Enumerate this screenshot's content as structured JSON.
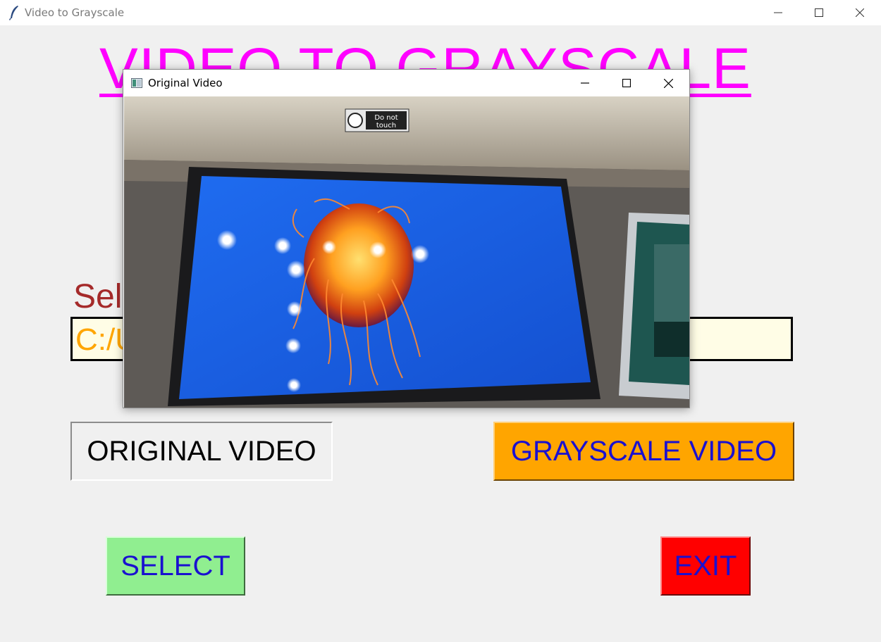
{
  "window": {
    "title": "Video to Grayscale",
    "icon": "feather-icon",
    "controls": [
      "minimize",
      "maximize",
      "close"
    ]
  },
  "main": {
    "heading": "VIDEO TO GRAYSCALE",
    "select_label": "Sel",
    "path_value": "C:/U"
  },
  "buttons": {
    "original": "ORIGINAL VIDEO",
    "grayscale": "GRAYSCALE VIDEO",
    "select": "SELECT",
    "exit": "EXIT"
  },
  "popup": {
    "title": "Original Video",
    "icon": "opencv-window-icon",
    "controls": [
      "minimize",
      "maximize",
      "close"
    ],
    "video_sign_line1": "Do not",
    "video_sign_line2": "touch"
  },
  "colors": {
    "heading": "#ff00ff",
    "label": "#a52a2a",
    "path_text": "#ffa500",
    "path_bg": "#fffde6",
    "grayscale_btn": "#ffa500",
    "select_btn": "#90ee90",
    "exit_btn": "#ff0000",
    "btn_text": "#1a10d0"
  }
}
